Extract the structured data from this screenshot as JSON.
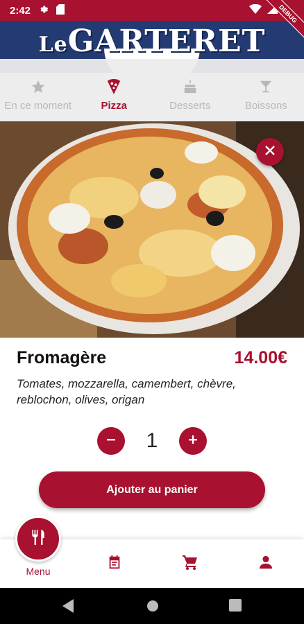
{
  "status_bar": {
    "time": "2:42",
    "debug_label": "DEBUG"
  },
  "header": {
    "logo_prefix": "Le",
    "logo_main": "GARTERET"
  },
  "categories": [
    {
      "label": "En ce moment",
      "icon": "star-icon",
      "active": false
    },
    {
      "label": "Pizza",
      "icon": "pizza-icon",
      "active": true
    },
    {
      "label": "Desserts",
      "icon": "cake-icon",
      "active": false
    },
    {
      "label": "Boissons",
      "icon": "cocktail-icon",
      "active": false
    }
  ],
  "product": {
    "name": "Fromagère",
    "price": "14.00€",
    "description": "Tomates, mozzarella, camembert, chèvre, reblochon, olives, origan",
    "quantity": "1"
  },
  "actions": {
    "add_to_cart": "Ajouter au panier"
  },
  "bottom_nav": {
    "items": [
      {
        "label": "Menu",
        "icon": "restaurant-icon",
        "active": true
      },
      {
        "label": "",
        "icon": "orders-icon"
      },
      {
        "label": "",
        "icon": "cart-icon"
      },
      {
        "label": "",
        "icon": "account-icon"
      }
    ]
  },
  "colors": {
    "brand": "#a8112f",
    "header_blue": "#243a73"
  }
}
